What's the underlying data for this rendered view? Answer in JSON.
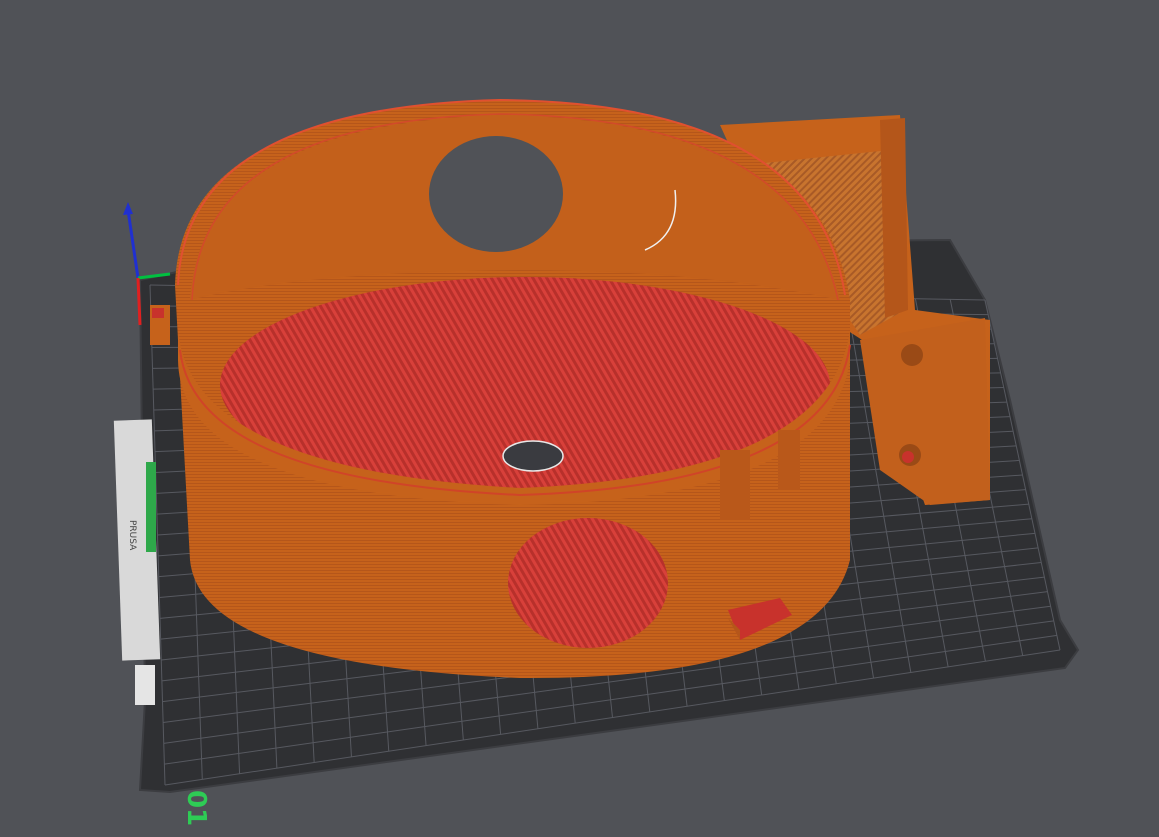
{
  "app": {
    "view": "3D preview"
  },
  "bed": {
    "plate_number": "01",
    "logo_text": "PRUSA",
    "colors": {
      "plate": "#2f3033",
      "grid": "#5a5c62",
      "edge": "#3a3b3f"
    }
  },
  "model": {
    "colors": {
      "perimeter": "#c8621a",
      "perimeter_dark": "#a9521a",
      "infill": "#c8322c",
      "shadow": "#8e4414"
    }
  },
  "axes": {
    "x_color": "#00c040",
    "y_color": "#e02020",
    "z_color": "#2030d0"
  }
}
